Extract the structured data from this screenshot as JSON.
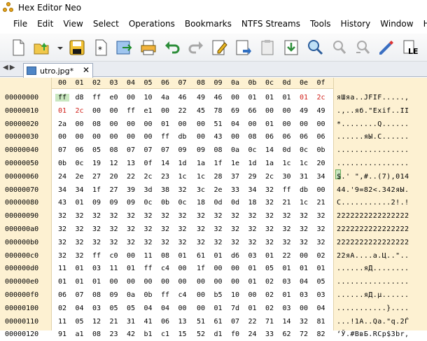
{
  "window": {
    "title": "Hex Editor Neo"
  },
  "menu": [
    "File",
    "Edit",
    "View",
    "Select",
    "Operations",
    "Bookmarks",
    "NTFS Streams",
    "Tools",
    "History",
    "Window",
    "Help"
  ],
  "toolbar": [
    "new-icon",
    "open-icon",
    "dropdown-icon",
    "save-icon",
    "save-all-icon",
    "save-as-icon",
    "print-icon",
    "undo-icon",
    "redo-icon",
    "edit-icon",
    "insert-icon",
    "paste-icon",
    "goto-icon",
    "find-icon",
    "find-next-icon",
    "replace-icon",
    "pattern-icon",
    "encoding-icon"
  ],
  "tab": {
    "label": "utro.jpg*",
    "close": "✕"
  },
  "header": [
    "00",
    "01",
    "02",
    "03",
    "04",
    "05",
    "06",
    "07",
    "08",
    "09",
    "0a",
    "0b",
    "0c",
    "0d",
    "0e",
    "0f"
  ],
  "rows": [
    {
      "off": "00000000",
      "hex": [
        "ff",
        "d8",
        "ff",
        "e0",
        "00",
        "10",
        "4a",
        "46",
        "49",
        "46",
        "00",
        "01",
        "01",
        "01",
        "01",
        "2c"
      ],
      "txt": "яШяа..JFIF.....,"
    },
    {
      "off": "00000010",
      "hex": [
        "01",
        "2c",
        "00",
        "00",
        "ff",
        "e1",
        "00",
        "22",
        "45",
        "78",
        "69",
        "66",
        "00",
        "00",
        "49",
        "49"
      ],
      "txt": ".,..яб.\"Exif..II"
    },
    {
      "off": "00000020",
      "hex": [
        "2a",
        "00",
        "08",
        "00",
        "00",
        "00",
        "01",
        "00",
        "00",
        "51",
        "04",
        "00",
        "01",
        "00",
        "00",
        "00"
      ],
      "txt": "*........Q......"
    },
    {
      "off": "00000030",
      "hex": [
        "00",
        "00",
        "00",
        "00",
        "00",
        "00",
        "ff",
        "db",
        "00",
        "43",
        "00",
        "08",
        "06",
        "06",
        "06",
        "06"
      ],
      "txt": "......яЫ.C......"
    },
    {
      "off": "00000040",
      "hex": [
        "07",
        "06",
        "05",
        "08",
        "07",
        "07",
        "07",
        "09",
        "09",
        "08",
        "0a",
        "0c",
        "14",
        "0d",
        "0c",
        "0b"
      ],
      "txt": "................"
    },
    {
      "off": "00000050",
      "hex": [
        "0b",
        "0c",
        "19",
        "12",
        "13",
        "0f",
        "14",
        "1d",
        "1a",
        "1f",
        "1e",
        "1d",
        "1a",
        "1c",
        "1c",
        "20"
      ],
      "txt": "................"
    },
    {
      "off": "00000060",
      "hex": [
        "24",
        "2e",
        "27",
        "20",
        "22",
        "2c",
        "23",
        "1c",
        "1c",
        "28",
        "37",
        "29",
        "2c",
        "30",
        "31",
        "34"
      ],
      "txt": "$.' \",#..(7),014"
    },
    {
      "off": "00000070",
      "hex": [
        "34",
        "34",
        "1f",
        "27",
        "39",
        "3d",
        "38",
        "32",
        "3c",
        "2e",
        "33",
        "34",
        "32",
        "ff",
        "db",
        "00"
      ],
      "txt": "44.'9=82<.342яЫ."
    },
    {
      "off": "00000080",
      "hex": [
        "43",
        "01",
        "09",
        "09",
        "09",
        "0c",
        "0b",
        "0c",
        "18",
        "0d",
        "0d",
        "18",
        "32",
        "21",
        "1c",
        "21"
      ],
      "txt": "C...........2!.!"
    },
    {
      "off": "00000090",
      "hex": [
        "32",
        "32",
        "32",
        "32",
        "32",
        "32",
        "32",
        "32",
        "32",
        "32",
        "32",
        "32",
        "32",
        "32",
        "32",
        "32"
      ],
      "txt": "2222222222222222"
    },
    {
      "off": "000000a0",
      "hex": [
        "32",
        "32",
        "32",
        "32",
        "32",
        "32",
        "32",
        "32",
        "32",
        "32",
        "32",
        "32",
        "32",
        "32",
        "32",
        "32"
      ],
      "txt": "2222222222222222"
    },
    {
      "off": "000000b0",
      "hex": [
        "32",
        "32",
        "32",
        "32",
        "32",
        "32",
        "32",
        "32",
        "32",
        "32",
        "32",
        "32",
        "32",
        "32",
        "32",
        "32"
      ],
      "txt": "2222222222222222"
    },
    {
      "off": "000000c0",
      "hex": [
        "32",
        "32",
        "ff",
        "c0",
        "00",
        "11",
        "08",
        "01",
        "61",
        "01",
        "d6",
        "03",
        "01",
        "22",
        "00",
        "02"
      ],
      "txt": "22яА....a.Ц..\".."
    },
    {
      "off": "000000d0",
      "hex": [
        "11",
        "01",
        "03",
        "11",
        "01",
        "ff",
        "c4",
        "00",
        "1f",
        "00",
        "00",
        "01",
        "05",
        "01",
        "01",
        "01"
      ],
      "txt": "......яД........"
    },
    {
      "off": "000000e0",
      "hex": [
        "01",
        "01",
        "01",
        "00",
        "00",
        "00",
        "00",
        "00",
        "00",
        "00",
        "00",
        "01",
        "02",
        "03",
        "04",
        "05"
      ],
      "txt": "................"
    },
    {
      "off": "000000f0",
      "hex": [
        "06",
        "07",
        "08",
        "09",
        "0a",
        "0b",
        "ff",
        "c4",
        "00",
        "b5",
        "10",
        "00",
        "02",
        "01",
        "03",
        "03"
      ],
      "txt": "......яД.µ......"
    },
    {
      "off": "00000100",
      "hex": [
        "02",
        "04",
        "03",
        "05",
        "05",
        "04",
        "04",
        "00",
        "00",
        "01",
        "7d",
        "01",
        "02",
        "03",
        "00",
        "04"
      ],
      "txt": "...........}...."
    },
    {
      "off": "00000110",
      "hex": [
        "11",
        "05",
        "12",
        "21",
        "31",
        "41",
        "06",
        "13",
        "51",
        "61",
        "07",
        "22",
        "71",
        "14",
        "32",
        "81"
      ],
      "txt": "...!1A..Qa.\"q.2Ѓ"
    },
    {
      "off": "00000120",
      "hex": [
        "91",
        "a1",
        "08",
        "23",
        "42",
        "b1",
        "c1",
        "15",
        "52",
        "d1",
        "f0",
        "24",
        "33",
        "62",
        "72",
        "82"
      ],
      "txt": "‘Ў.#BвБ.RСр$3br‚"
    }
  ]
}
